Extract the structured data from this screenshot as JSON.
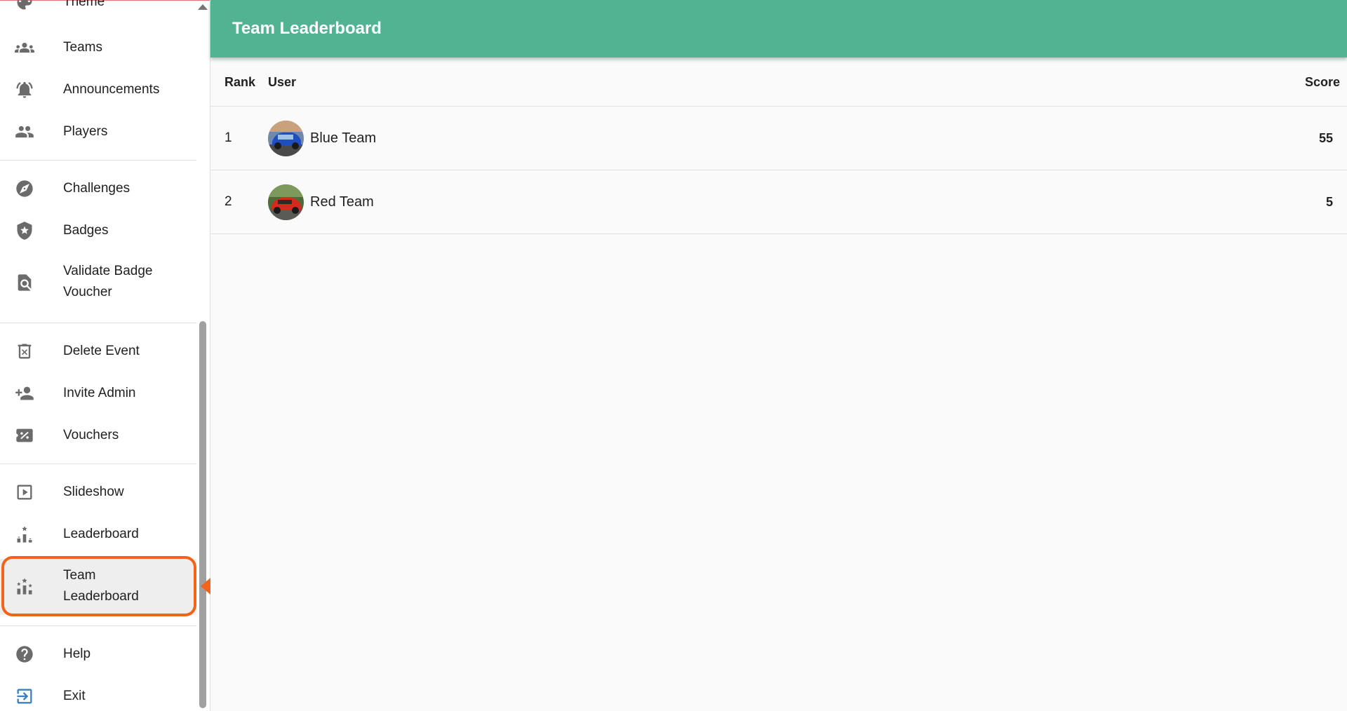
{
  "sidebar": {
    "items": [
      {
        "label": "Theme",
        "icon": "palette-icon"
      },
      {
        "label": "Teams",
        "icon": "groups-icon"
      },
      {
        "label": "Announcements",
        "icon": "bell-ringing-icon"
      },
      {
        "label": "Players",
        "icon": "people-icon"
      },
      {
        "label": "Challenges",
        "icon": "compass-icon"
      },
      {
        "label": "Badges",
        "icon": "shield-star-icon"
      },
      {
        "label": "Validate Badge Voucher",
        "icon": "search-document-icon"
      },
      {
        "label": "Delete Event",
        "icon": "delete-icon"
      },
      {
        "label": "Invite Admin",
        "icon": "person-add-icon"
      },
      {
        "label": "Vouchers",
        "icon": "voucher-percent-icon"
      },
      {
        "label": "Slideshow",
        "icon": "play-box-icon"
      },
      {
        "label": "Leaderboard",
        "icon": "podium-icon"
      },
      {
        "label": "Team Leaderboard",
        "icon": "podium-stars-icon"
      },
      {
        "label": "Help",
        "icon": "help-circle-icon"
      },
      {
        "label": "Exit",
        "icon": "exit-icon"
      }
    ],
    "validate_line1": "Validate Badge",
    "validate_line2": "Voucher",
    "team_lb_line1": "Team",
    "team_lb_line2": "Leaderboard"
  },
  "header": {
    "title": "Team Leaderboard"
  },
  "table": {
    "columns": {
      "rank": "Rank",
      "user": "User",
      "score": "Score"
    },
    "rows": [
      {
        "rank": "1",
        "name": "Blue Team",
        "score": "55"
      },
      {
        "rank": "2",
        "name": "Red Team",
        "score": "5"
      }
    ]
  },
  "colors": {
    "header": "#52b393",
    "highlight": "#f26419"
  }
}
